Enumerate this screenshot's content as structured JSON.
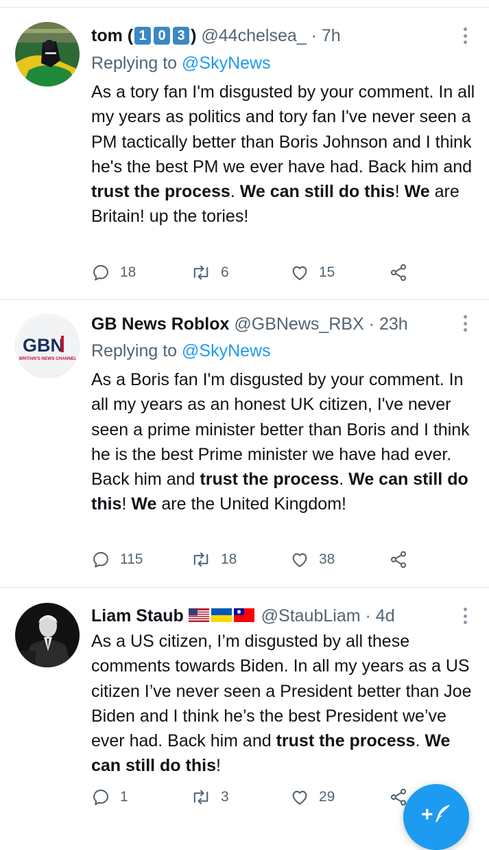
{
  "tweets": [
    {
      "name": "tom (",
      "name_suffix": ")",
      "name_numbers": [
        "1",
        "0",
        "3"
      ],
      "handle": "@44chelsea_",
      "dot": "·",
      "time": "7h",
      "replying_prefix": "Replying to ",
      "replying_mention": "@SkyNews",
      "body": [
        {
          "t": "As a tory fan I'm disgusted by your comment. In all my years as politics and tory fan I've never seen a PM tactically better than Boris Johnson and I think he's the best PM we ever have had. Back him and "
        },
        {
          "b": "trust the process"
        },
        {
          "t": ". "
        },
        {
          "b": "We can still do this"
        },
        {
          "t": "! "
        },
        {
          "b": "We"
        },
        {
          "t": " are Britain! up the tories!"
        }
      ],
      "replies": "18",
      "retweets": "6",
      "likes": "15"
    },
    {
      "name": "GB News Roblox",
      "handle": "@GBNews_RBX",
      "dot": "·",
      "time": "23h",
      "replying_prefix": "Replying to ",
      "replying_mention": "@SkyNews",
      "avatar_logo": "GBN",
      "avatar_tagline": "BRITAIN'S NEWS CHANNEL",
      "body": [
        {
          "t": "As a Boris fan I'm disgusted by your comment. In all my years as an honest UK citizen, I've never seen a prime minister better than Boris and I think he is the best Prime minister we have had ever. Back him and "
        },
        {
          "b": "trust the process"
        },
        {
          "t": ". "
        },
        {
          "b": "We can still do this"
        },
        {
          "t": "! "
        },
        {
          "b": "We"
        },
        {
          "t": " are the United Kingdom!"
        }
      ],
      "replies": "115",
      "retweets": "18",
      "likes": "38"
    },
    {
      "name": "Liam Staub",
      "handle": "@StaubLiam",
      "dot": "·",
      "time": "4d",
      "name_flags": [
        "us-flag-icon",
        "ukraine-flag-icon",
        "taiwan-flag-icon"
      ],
      "body": [
        {
          "t": "As a US citizen, I’m disgusted by all these comments towards Biden. In all my years as a US citizen I’ve never seen a President better than Joe Biden and I think he’s the best President we’ve ever had. Back him and "
        },
        {
          "b": "trust the process"
        },
        {
          "t": ". "
        },
        {
          "b": "We can still do this"
        },
        {
          "t": "!"
        }
      ],
      "replies": "1",
      "retweets": "3",
      "likes": "29"
    }
  ],
  "fab": {
    "icon": "compose-tweet-icon",
    "plus": "+"
  },
  "colors": {
    "accent": "#1d9bf0",
    "secondary_text": "#536471",
    "divider": "#e1e6ea",
    "keycap": "#3b88c3"
  }
}
